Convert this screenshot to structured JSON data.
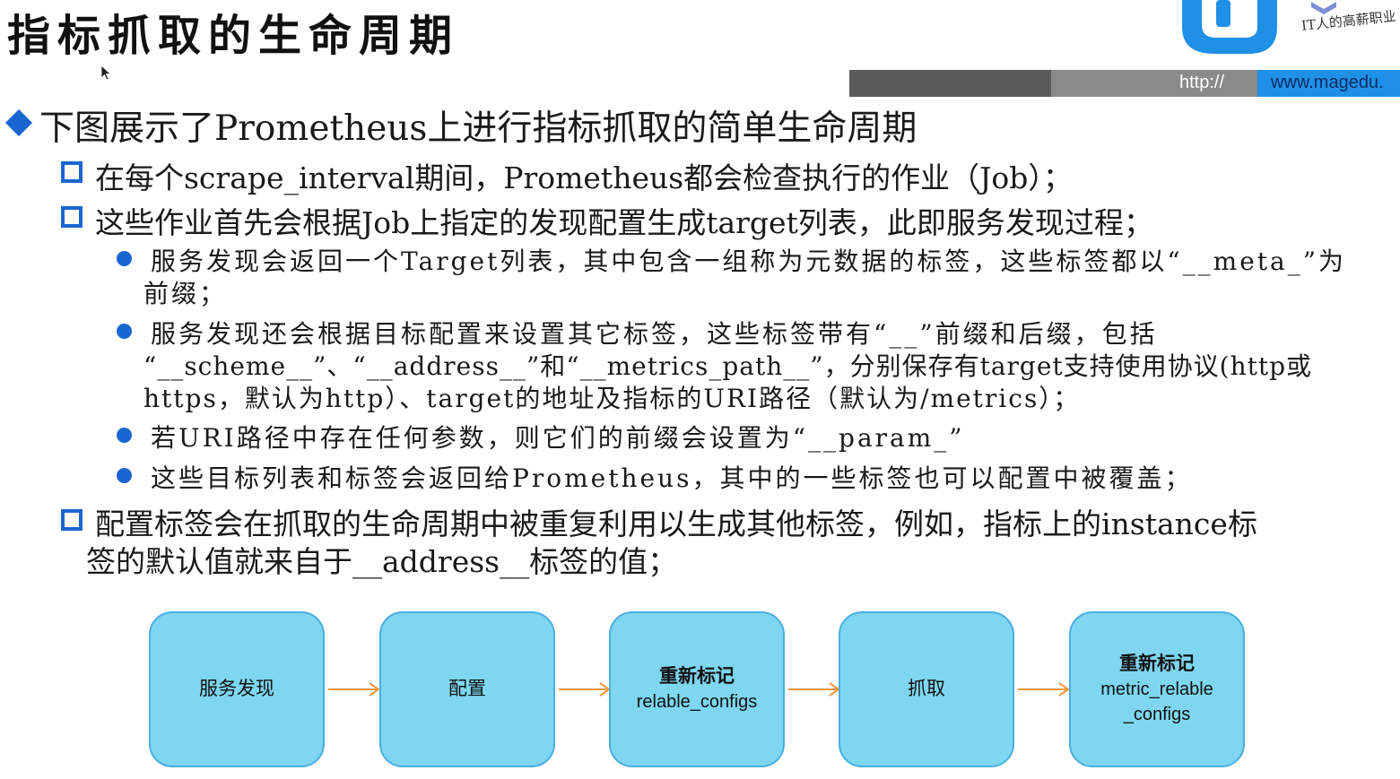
{
  "header": {
    "title": "指标抓取的生命周期",
    "slogan": "IT人的高薪职业",
    "url_scheme": "http://",
    "url_host": "www.magedu."
  },
  "content": {
    "heading": "下图展示了Prometheus上进行指标抓取的简单生命周期",
    "bullet_1": "在每个scrape_interval期间，Prometheus都会检查执行的作业（Job）；",
    "bullet_2": "这些作业首先会根据Job上指定的发现配置生成target列表，此即服务发现过程；",
    "sub_1_line1": "服务发现会返回一个Target列表，其中包含一组称为元数据的标签，这些标签都以“__meta_”为",
    "sub_1_line2": "前缀；",
    "sub_2_line1": "服务发现还会根据目标配置来设置其它标签，这些标签带有“__”前缀和后缀，包括",
    "sub_2_line2": "“__scheme__”、“__address__”和“__metrics_path__”，分别保存有target支持使用协议(http或",
    "sub_2_line3": "https，默认为http）、target的地址及指标的URI路径（默认为/metrics）；",
    "sub_3": "若URI路径中存在任何参数，则它们的前缀会设置为“__param_”",
    "sub_4": "这些目标列表和标签会返回给Prometheus，其中的一些标签也可以配置中被覆盖；",
    "bullet_3_line1": "配置标签会在抓取的生命周期中被重复利用以生成其他标签，例如，指标上的instance标",
    "bullet_3_line2": "签的默认值就来自于__address__标签的值；"
  },
  "flow": {
    "step_1": "服务发现",
    "step_2": "配置",
    "step_3_title": "重新标记",
    "step_3_sub": "relable_configs",
    "step_4": "抓取",
    "step_5_title": "重新标记",
    "step_5_sub1": "metric_relable",
    "step_5_sub2": "_configs"
  },
  "colors": {
    "accent_blue": "#1a66d0",
    "box_fill": "#7ed6f1",
    "box_border": "#4aaee0",
    "arrow": "#f0963c",
    "url_blue": "#1e90e6"
  }
}
